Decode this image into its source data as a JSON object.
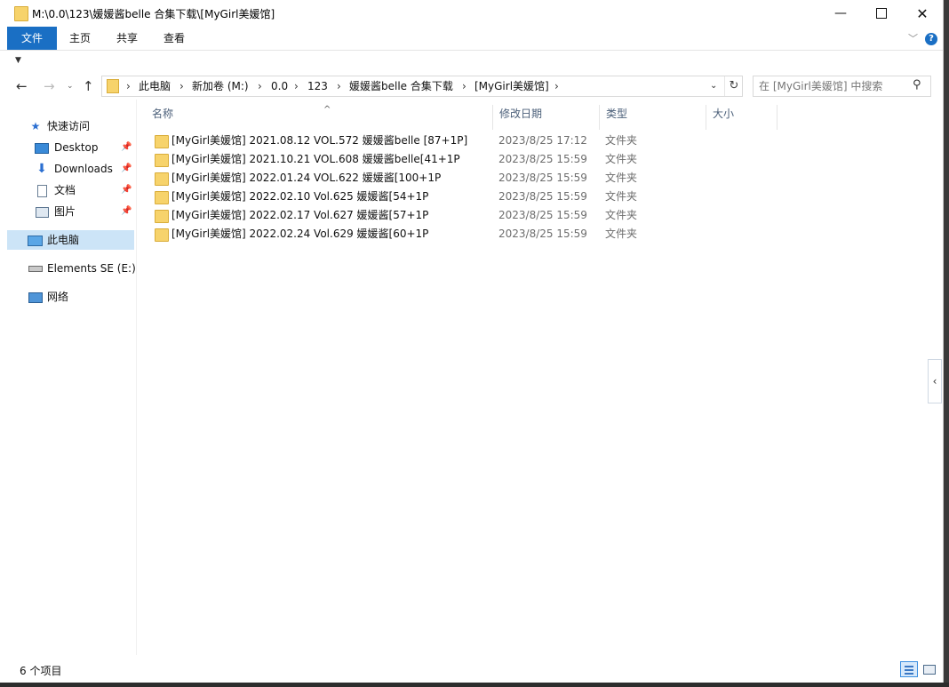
{
  "window": {
    "title": "M:\\0.0\\123\\媛媛酱belle 合集下载\\[MyGirl美媛馆]",
    "controls": {
      "minimize": "—",
      "close": "✕"
    }
  },
  "ribbon": {
    "tabs": {
      "file": "文件",
      "home": "主页",
      "share": "共享",
      "view": "查看"
    },
    "expand_icon": "chevron-down-icon",
    "help_label": "?"
  },
  "address_bar": {
    "crumbs": [
      "此电脑",
      "新加卷 (M:)",
      "0.0",
      "123",
      "媛媛酱belle 合集下载",
      "[MyGirl美媛馆]"
    ]
  },
  "search": {
    "placeholder": "在 [MyGirl美媛馆] 中搜索"
  },
  "sidebar": {
    "quick_access": "快速访问",
    "pinned": [
      "Desktop",
      "Downloads",
      "文档",
      "图片"
    ],
    "this_pc": "此电脑",
    "drive": "Elements SE (E:)",
    "network": "网络"
  },
  "columns": {
    "name": "名称",
    "modified": "修改日期",
    "type": "类型",
    "size": "大小"
  },
  "files": [
    {
      "name": "[MyGirl美媛馆] 2021.08.12 VOL.572 媛媛酱belle [87+1P]",
      "modified": "2023/8/25 17:12",
      "type": "文件夹"
    },
    {
      "name": "[MyGirl美媛馆] 2021.10.21 VOL.608 媛媛酱belle[41+1P",
      "modified": "2023/8/25 15:59",
      "type": "文件夹"
    },
    {
      "name": "[MyGirl美媛馆] 2022.01.24 VOL.622 媛媛酱[100+1P",
      "modified": "2023/8/25 15:59",
      "type": "文件夹"
    },
    {
      "name": "[MyGirl美媛馆] 2022.02.10 Vol.625 媛媛酱[54+1P",
      "modified": "2023/8/25 15:59",
      "type": "文件夹"
    },
    {
      "name": "[MyGirl美媛馆] 2022.02.17 Vol.627 媛媛酱[57+1P",
      "modified": "2023/8/25 15:59",
      "type": "文件夹"
    },
    {
      "name": "[MyGirl美媛馆] 2022.02.24 Vol.629 媛媛酱[60+1P",
      "modified": "2023/8/25 15:59",
      "type": "文件夹"
    }
  ],
  "status": {
    "count": "6 个项目"
  },
  "colors": {
    "accent": "#1a6fc4",
    "selection": "#cce4f7",
    "folder": "#f7d36b"
  }
}
